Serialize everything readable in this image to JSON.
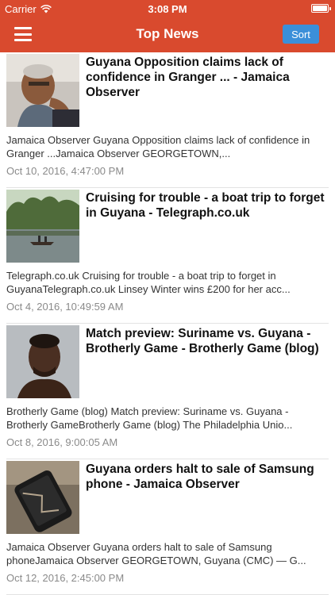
{
  "status_bar": {
    "carrier": "Carrier",
    "time": "3:08 PM",
    "wifi_icon": "wifi-icon",
    "battery_icon": "battery-icon"
  },
  "nav": {
    "title": "Top News",
    "sort_label": "Sort",
    "menu_icon": "hamburger-menu-icon"
  },
  "colors": {
    "header": "#d94a2e",
    "sort_button": "#3b8fd9",
    "date_text": "#8a8a8a"
  },
  "articles": [
    {
      "headline": "Guyana Opposition claims lack of confidence in Granger ... - Jamaica Observer",
      "snippet": "Jamaica Observer    Guyana Opposition claims lack of confidence in Granger ...Jamaica Observer  GEORGETOWN,...",
      "date": "Oct 10, 2016, 4:47:00 PM",
      "thumbnail": "man-portrait-thumbnail"
    },
    {
      "headline": "Cruising for trouble - a boat trip to forget in Guyana - Telegraph.co.uk",
      "snippet": "Telegraph.co.uk    Cruising for trouble - a boat trip to forget in GuyanaTelegraph.co.uk  Linsey Winter wins £200 for her acc...",
      "date": "Oct 4, 2016, 10:49:59 AM",
      "thumbnail": "river-boat-thumbnail"
    },
    {
      "headline": "Match preview: Suriname vs. Guyana - Brotherly Game - Brotherly Game (blog)",
      "snippet": "Brotherly Game (blog)    Match preview: Suriname vs. Guyana - Brotherly GameBrotherly Game (blog)  The Philadelphia Unio...",
      "date": "Oct 8, 2016, 9:00:05 AM",
      "thumbnail": "player-portrait-thumbnail"
    },
    {
      "headline": "Guyana orders halt to sale of Samsung phone - Jamaica Observer",
      "snippet": "Jamaica Observer    Guyana orders halt to sale of Samsung phoneJamaica Observer  GEORGETOWN, Guyana (CMC) — G...",
      "date": "Oct 12, 2016, 2:45:00 PM",
      "thumbnail": "burnt-phone-thumbnail"
    }
  ]
}
